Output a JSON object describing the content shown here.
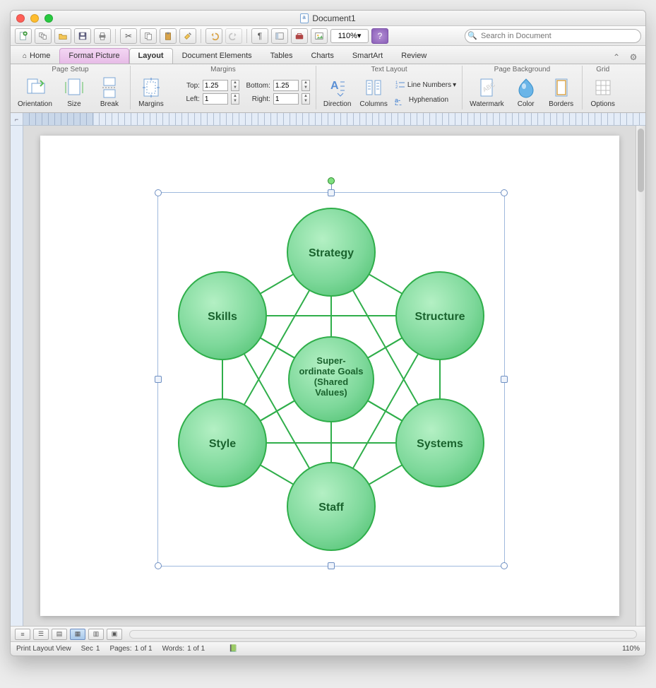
{
  "window": {
    "title": "Document1"
  },
  "quickbar": {
    "zoom": "110%",
    "search_placeholder": "Search in Document"
  },
  "tabs": {
    "home": "Home",
    "format_picture": "Format Picture",
    "layout": "Layout",
    "document_elements": "Document Elements",
    "tables": "Tables",
    "charts": "Charts",
    "smartart": "SmartArt",
    "review": "Review"
  },
  "ribbon": {
    "groups": {
      "page_setup": {
        "label": "Page Setup",
        "orientation": "Orientation",
        "size": "Size",
        "break": "Break"
      },
      "margins": {
        "label": "Margins",
        "button": "Margins",
        "top": "Top:",
        "top_v": "1.25",
        "bottom": "Bottom:",
        "bottom_v": "1.25",
        "left": "Left:",
        "left_v": "1",
        "right": "Right:",
        "right_v": "1"
      },
      "text_layout": {
        "label": "Text Layout",
        "direction": "Direction",
        "columns": "Columns",
        "line_numbers": "Line Numbers",
        "hyphenation": "Hyphenation"
      },
      "page_background": {
        "label": "Page Background",
        "watermark": "Watermark",
        "color": "Color",
        "borders": "Borders"
      },
      "grid": {
        "label": "Grid",
        "options": "Options"
      }
    }
  },
  "diagram": {
    "nodes": {
      "center": "Super-ordinate Goals (Shared Values)",
      "top": "Strategy",
      "tr": "Structure",
      "br": "Systems",
      "bottom": "Staff",
      "bl": "Style",
      "tl": "Skills"
    }
  },
  "statusbar": {
    "view": "Print Layout View",
    "sec_l": "Sec",
    "sec_v": "1",
    "pages_l": "Pages:",
    "pages_v": "1 of 1",
    "words_l": "Words:",
    "words_v": "1 of 1",
    "zoom": "110%"
  }
}
